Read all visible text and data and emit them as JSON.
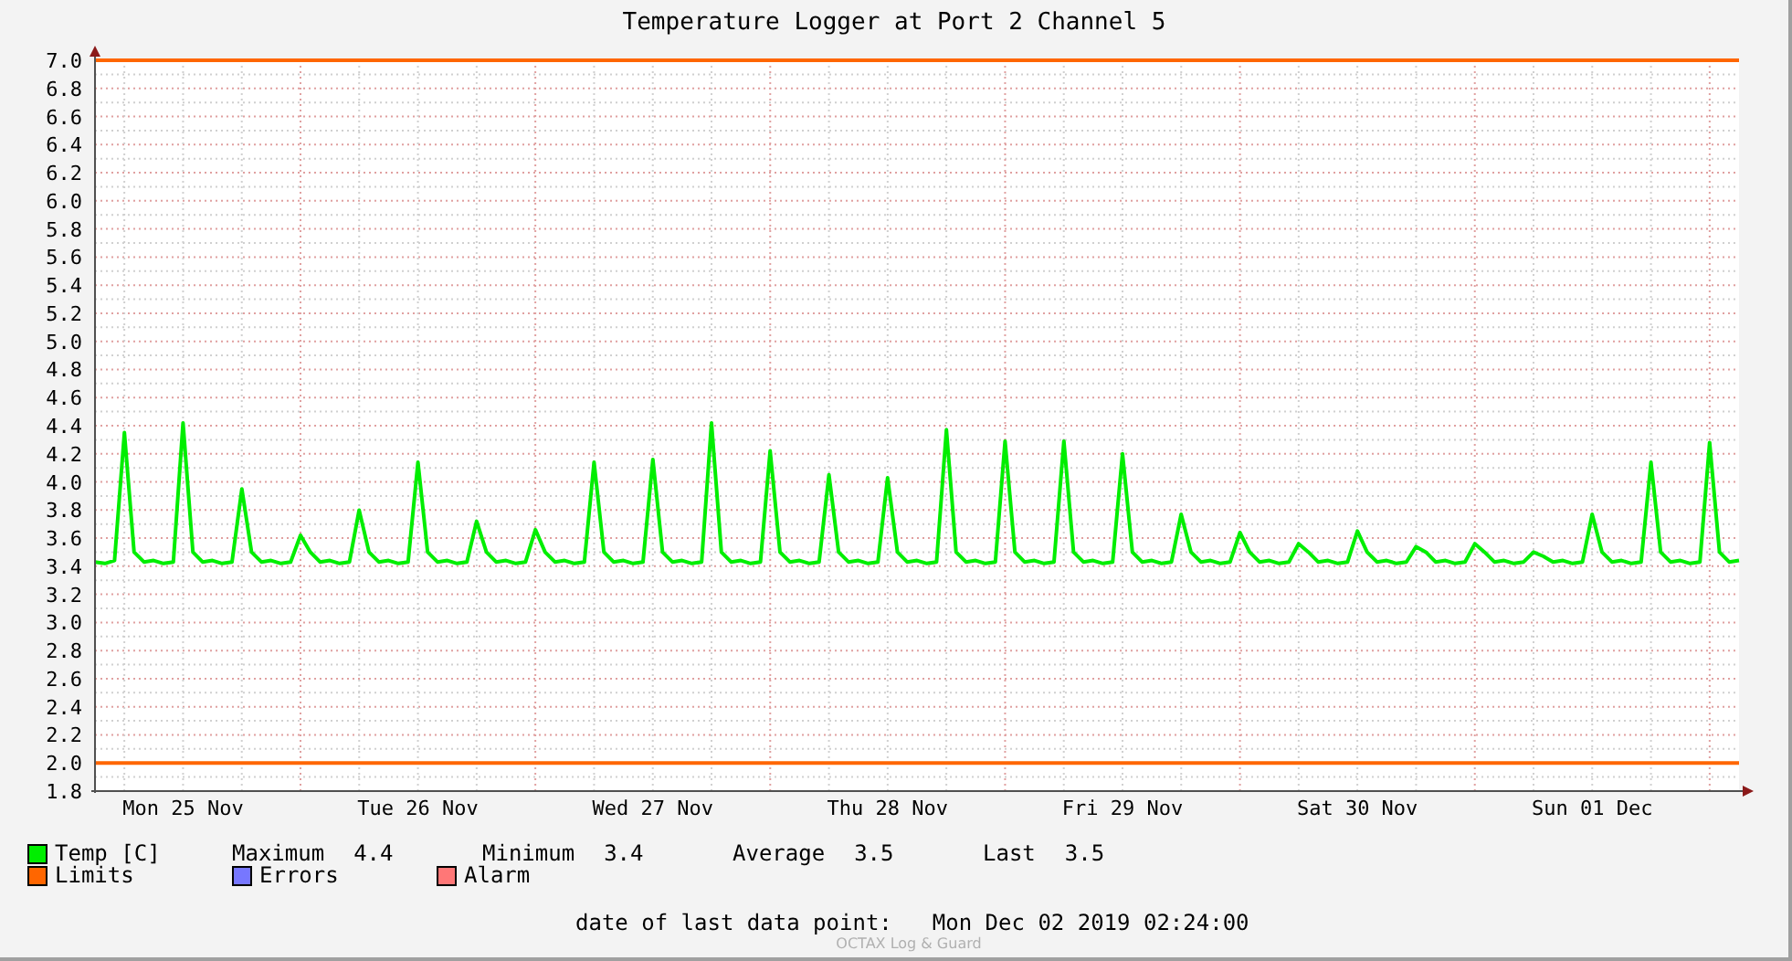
{
  "title": "Temperature Logger at Port 2 Channel 5",
  "chart_data": {
    "type": "line",
    "ylim": [
      1.8,
      7.0
    ],
    "yticks": [
      {
        "value": 1.8,
        "label": "1.8"
      },
      {
        "value": 2.0,
        "label": "2.0"
      },
      {
        "value": 2.2,
        "label": "2.2"
      },
      {
        "value": 2.4,
        "label": "2.4"
      },
      {
        "value": 2.6,
        "label": "2.6"
      },
      {
        "value": 2.8,
        "label": "2.8"
      },
      {
        "value": 3.0,
        "label": "3.0"
      },
      {
        "value": 3.2,
        "label": "3.2"
      },
      {
        "value": 3.4,
        "label": "3.4"
      },
      {
        "value": 3.6,
        "label": "3.6"
      },
      {
        "value": 3.8,
        "label": "3.8"
      },
      {
        "value": 4.0,
        "label": "4.0"
      },
      {
        "value": 4.2,
        "label": "4.2"
      },
      {
        "value": 4.4,
        "label": "4.4"
      },
      {
        "value": 4.6,
        "label": "4.6"
      },
      {
        "value": 4.8,
        "label": "4.8"
      },
      {
        "value": 5.0,
        "label": "5.0"
      },
      {
        "value": 5.2,
        "label": "5.2"
      },
      {
        "value": 5.4,
        "label": "5.4"
      },
      {
        "value": 5.6,
        "label": "5.6"
      },
      {
        "value": 5.8,
        "label": "5.8"
      },
      {
        "value": 6.0,
        "label": "6.0"
      },
      {
        "value": 6.2,
        "label": "6.2"
      },
      {
        "value": 6.4,
        "label": "6.4"
      },
      {
        "value": 6.6,
        "label": "6.6"
      },
      {
        "value": 6.8,
        "label": "6.8"
      },
      {
        "value": 7.0,
        "label": "7.0"
      }
    ],
    "categories": [
      null,
      null,
      null,
      null,
      null,
      null,
      null,
      null,
      null,
      "Mon 25 Nov",
      null,
      null,
      null,
      null,
      null,
      null,
      null,
      null,
      null,
      null,
      null,
      null,
      null,
      null,
      null,
      null,
      null,
      null,
      null,
      null,
      null,
      null,
      null,
      "Tue 26 Nov",
      null,
      null,
      null,
      null,
      null,
      null,
      null,
      null,
      null,
      null,
      null,
      null,
      null,
      null,
      null,
      null,
      null,
      null,
      null,
      null,
      null,
      null,
      null,
      "Wed 27 Nov",
      null,
      null,
      null,
      null,
      null,
      null,
      null,
      null,
      null,
      null,
      null,
      null,
      null,
      null,
      null,
      null,
      null,
      null,
      null,
      null,
      null,
      null,
      null,
      "Thu 28 Nov",
      null,
      null,
      null,
      null,
      null,
      null,
      null,
      null,
      null,
      null,
      null,
      null,
      null,
      null,
      null,
      null,
      null,
      null,
      null,
      null,
      null,
      null,
      null,
      "Fri 29 Nov",
      null,
      null,
      null,
      null,
      null,
      null,
      null,
      null,
      null,
      null,
      null,
      null,
      null,
      null,
      null,
      null,
      null,
      null,
      null,
      null,
      null,
      null,
      null,
      "Sat 30 Nov",
      null,
      null,
      null,
      null,
      null,
      null,
      null,
      null,
      null,
      null,
      null,
      null,
      null,
      null,
      null,
      null,
      null,
      null,
      null,
      null,
      null,
      null,
      null,
      "Sun 01 Dec",
      null,
      null,
      null,
      null,
      null,
      null,
      null,
      null,
      null,
      null,
      null,
      null,
      null,
      null,
      null
    ],
    "series": [
      {
        "name": "Temp [C]",
        "color": "#00ee00",
        "values": [
          3.43,
          3.42,
          3.44,
          4.35,
          3.5,
          3.43,
          3.44,
          3.42,
          3.43,
          4.42,
          3.5,
          3.43,
          3.44,
          3.42,
          3.43,
          3.95,
          3.5,
          3.43,
          3.44,
          3.42,
          3.43,
          3.62,
          3.5,
          3.43,
          3.44,
          3.42,
          3.43,
          3.8,
          3.5,
          3.43,
          3.44,
          3.42,
          3.43,
          4.14,
          3.5,
          3.43,
          3.44,
          3.42,
          3.43,
          3.72,
          3.5,
          3.43,
          3.44,
          3.42,
          3.43,
          3.66,
          3.5,
          3.43,
          3.44,
          3.42,
          3.43,
          4.14,
          3.5,
          3.43,
          3.44,
          3.42,
          3.43,
          4.16,
          3.5,
          3.43,
          3.44,
          3.42,
          3.43,
          4.42,
          3.5,
          3.43,
          3.44,
          3.42,
          3.43,
          4.22,
          3.5,
          3.43,
          3.44,
          3.42,
          3.43,
          4.05,
          3.5,
          3.43,
          3.44,
          3.42,
          3.43,
          4.03,
          3.5,
          3.43,
          3.44,
          3.42,
          3.43,
          4.37,
          3.5,
          3.43,
          3.44,
          3.42,
          3.43,
          4.29,
          3.5,
          3.43,
          3.44,
          3.42,
          3.43,
          4.29,
          3.5,
          3.43,
          3.44,
          3.42,
          3.43,
          4.2,
          3.5,
          3.43,
          3.44,
          3.42,
          3.43,
          3.77,
          3.5,
          3.43,
          3.44,
          3.42,
          3.43,
          3.64,
          3.5,
          3.43,
          3.44,
          3.42,
          3.43,
          3.56,
          3.5,
          3.43,
          3.44,
          3.42,
          3.43,
          3.65,
          3.5,
          3.43,
          3.44,
          3.42,
          3.43,
          3.54,
          3.5,
          3.43,
          3.44,
          3.42,
          3.43,
          3.56,
          3.5,
          3.43,
          3.44,
          3.42,
          3.43,
          3.5,
          3.47,
          3.43,
          3.44,
          3.42,
          3.43,
          3.77,
          3.5,
          3.43,
          3.44,
          3.42,
          3.43,
          4.14,
          3.5,
          3.43,
          3.44,
          3.42,
          3.43,
          4.28,
          3.5,
          3.43,
          3.44
        ]
      }
    ],
    "grid": true,
    "ref_lines": [
      {
        "axis": "y",
        "value": 7.0
      },
      {
        "axis": "y",
        "value": 2.0
      }
    ]
  },
  "legend": [
    {
      "label": "Limits",
      "color": "#ff6600"
    },
    {
      "label": "Errors",
      "color": "#7777ff"
    },
    {
      "label": "Alarm",
      "color": "#ff7777"
    }
  ],
  "statistics": [
    {
      "label": "Maximum",
      "value": "4.4"
    },
    {
      "label": "Minimum",
      "value": "3.4"
    },
    {
      "label": "Average",
      "value": "3.5"
    },
    {
      "label": "Last",
      "value": "3.5"
    }
  ],
  "last_data_point": {
    "label": "date of last data point:",
    "value": "Mon Dec 02 2019 02:24:00"
  },
  "footer": "OCTAX Log & Guard"
}
